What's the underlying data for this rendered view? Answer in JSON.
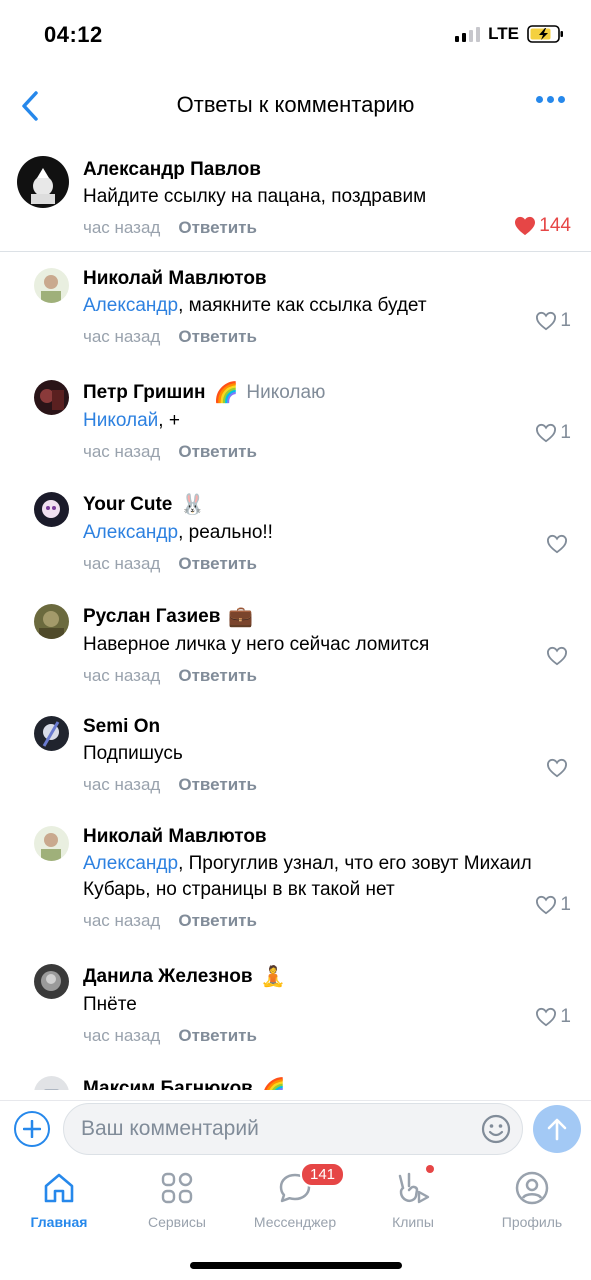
{
  "status": {
    "time": "04:12",
    "network": "LTE"
  },
  "nav": {
    "title": "Ответы к комментарию",
    "back_icon": "chevron-left-icon",
    "more_icon": "more-horizontal-icon"
  },
  "root_comment": {
    "author": "Александр Павлов",
    "text": "Найдите ссылку на пацана, поздравим",
    "time": "час назад",
    "reply_label": "Ответить",
    "likes": "144",
    "liked": true
  },
  "replies": [
    {
      "author": "Николай Мавлютов",
      "emoji": "",
      "reply_to": "",
      "mention": "Александр",
      "text": ", маякните как ссылка будет",
      "time": "час назад",
      "reply_label": "Ответить",
      "likes": "1"
    },
    {
      "author": "Петр Гришин",
      "emoji": "🌈",
      "reply_to": "Николаю",
      "mention": "Николай",
      "text": ", +",
      "time": "час назад",
      "reply_label": "Ответить",
      "likes": "1"
    },
    {
      "author": "Your Cute",
      "emoji": "🐰",
      "reply_to": "",
      "mention": "Александр",
      "text": ", реально!!",
      "time": "час назад",
      "reply_label": "Ответить",
      "likes": ""
    },
    {
      "author": "Руслан Газиев",
      "emoji": "💼",
      "reply_to": "",
      "mention": "",
      "text": "Наверное личка у него сейчас ломится",
      "time": "час назад",
      "reply_label": "Ответить",
      "likes": ""
    },
    {
      "author": "Semi On",
      "emoji": "",
      "reply_to": "",
      "mention": "",
      "text": "Подпишусь",
      "time": "час назад",
      "reply_label": "Ответить",
      "likes": ""
    },
    {
      "author": "Николай Мавлютов",
      "emoji": "",
      "reply_to": "",
      "mention": "Александр",
      "text": ", Прогуглив узнал, что его зовут Михаил Кубарь, но страницы в вк такой нет",
      "time": "час назад",
      "reply_label": "Ответить",
      "likes": "1"
    },
    {
      "author": "Данила Железнов",
      "emoji": "🧘",
      "reply_to": "",
      "mention": "",
      "text": "Пнёте",
      "time": "час назад",
      "reply_label": "Ответить",
      "likes": "1"
    },
    {
      "author": "Максим Багнюков",
      "emoji": "🌈",
      "reply_to": "",
      "mention": "",
      "text": "",
      "time": "",
      "reply_label": "",
      "likes": ""
    }
  ],
  "composer": {
    "placeholder": "Ваш комментарий"
  },
  "tabbar": {
    "home": "Главная",
    "services": "Сервисы",
    "messenger": "Мессенджер",
    "messenger_badge": "141",
    "clips": "Клипы",
    "profile": "Профиль"
  },
  "colors": {
    "accent": "#2688eb",
    "like_red": "#e64646",
    "mention": "#2d81e0",
    "muted": "#818c99"
  }
}
